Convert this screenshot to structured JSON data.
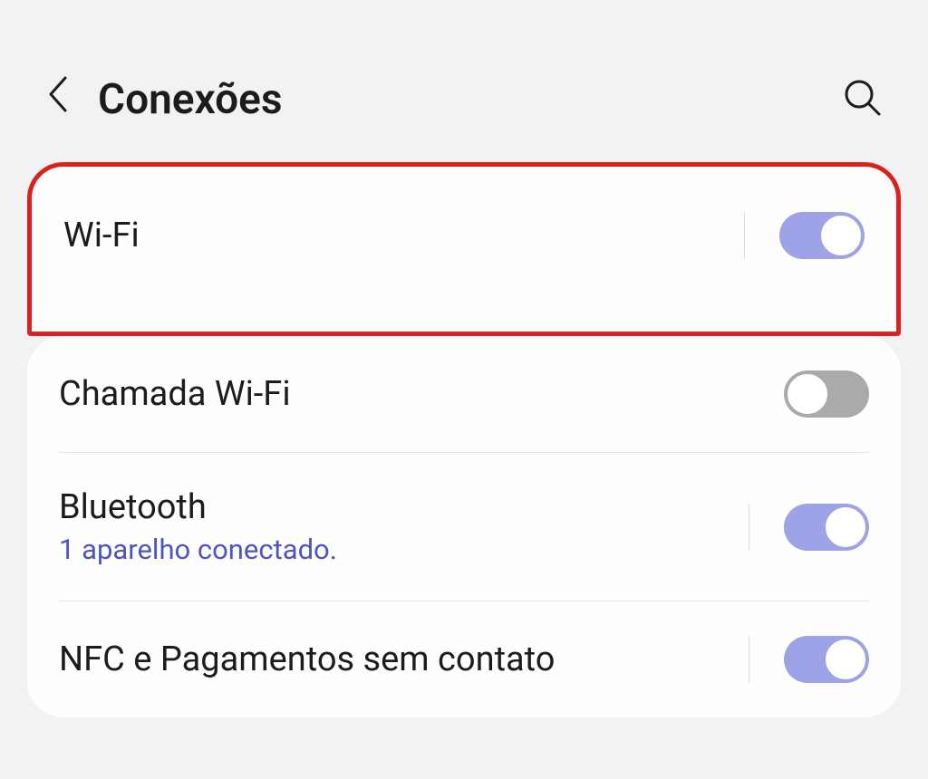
{
  "header": {
    "title": "Conexões"
  },
  "settings": {
    "wifi": {
      "label": "Wi-Fi",
      "enabled": true
    },
    "wifi_calling": {
      "label": "Chamada Wi-Fi",
      "enabled": false
    },
    "bluetooth": {
      "label": "Bluetooth",
      "sublabel": "1 aparelho conectado.",
      "enabled": true
    },
    "nfc": {
      "label": "NFC e Pagamentos sem contato",
      "enabled": true
    }
  }
}
